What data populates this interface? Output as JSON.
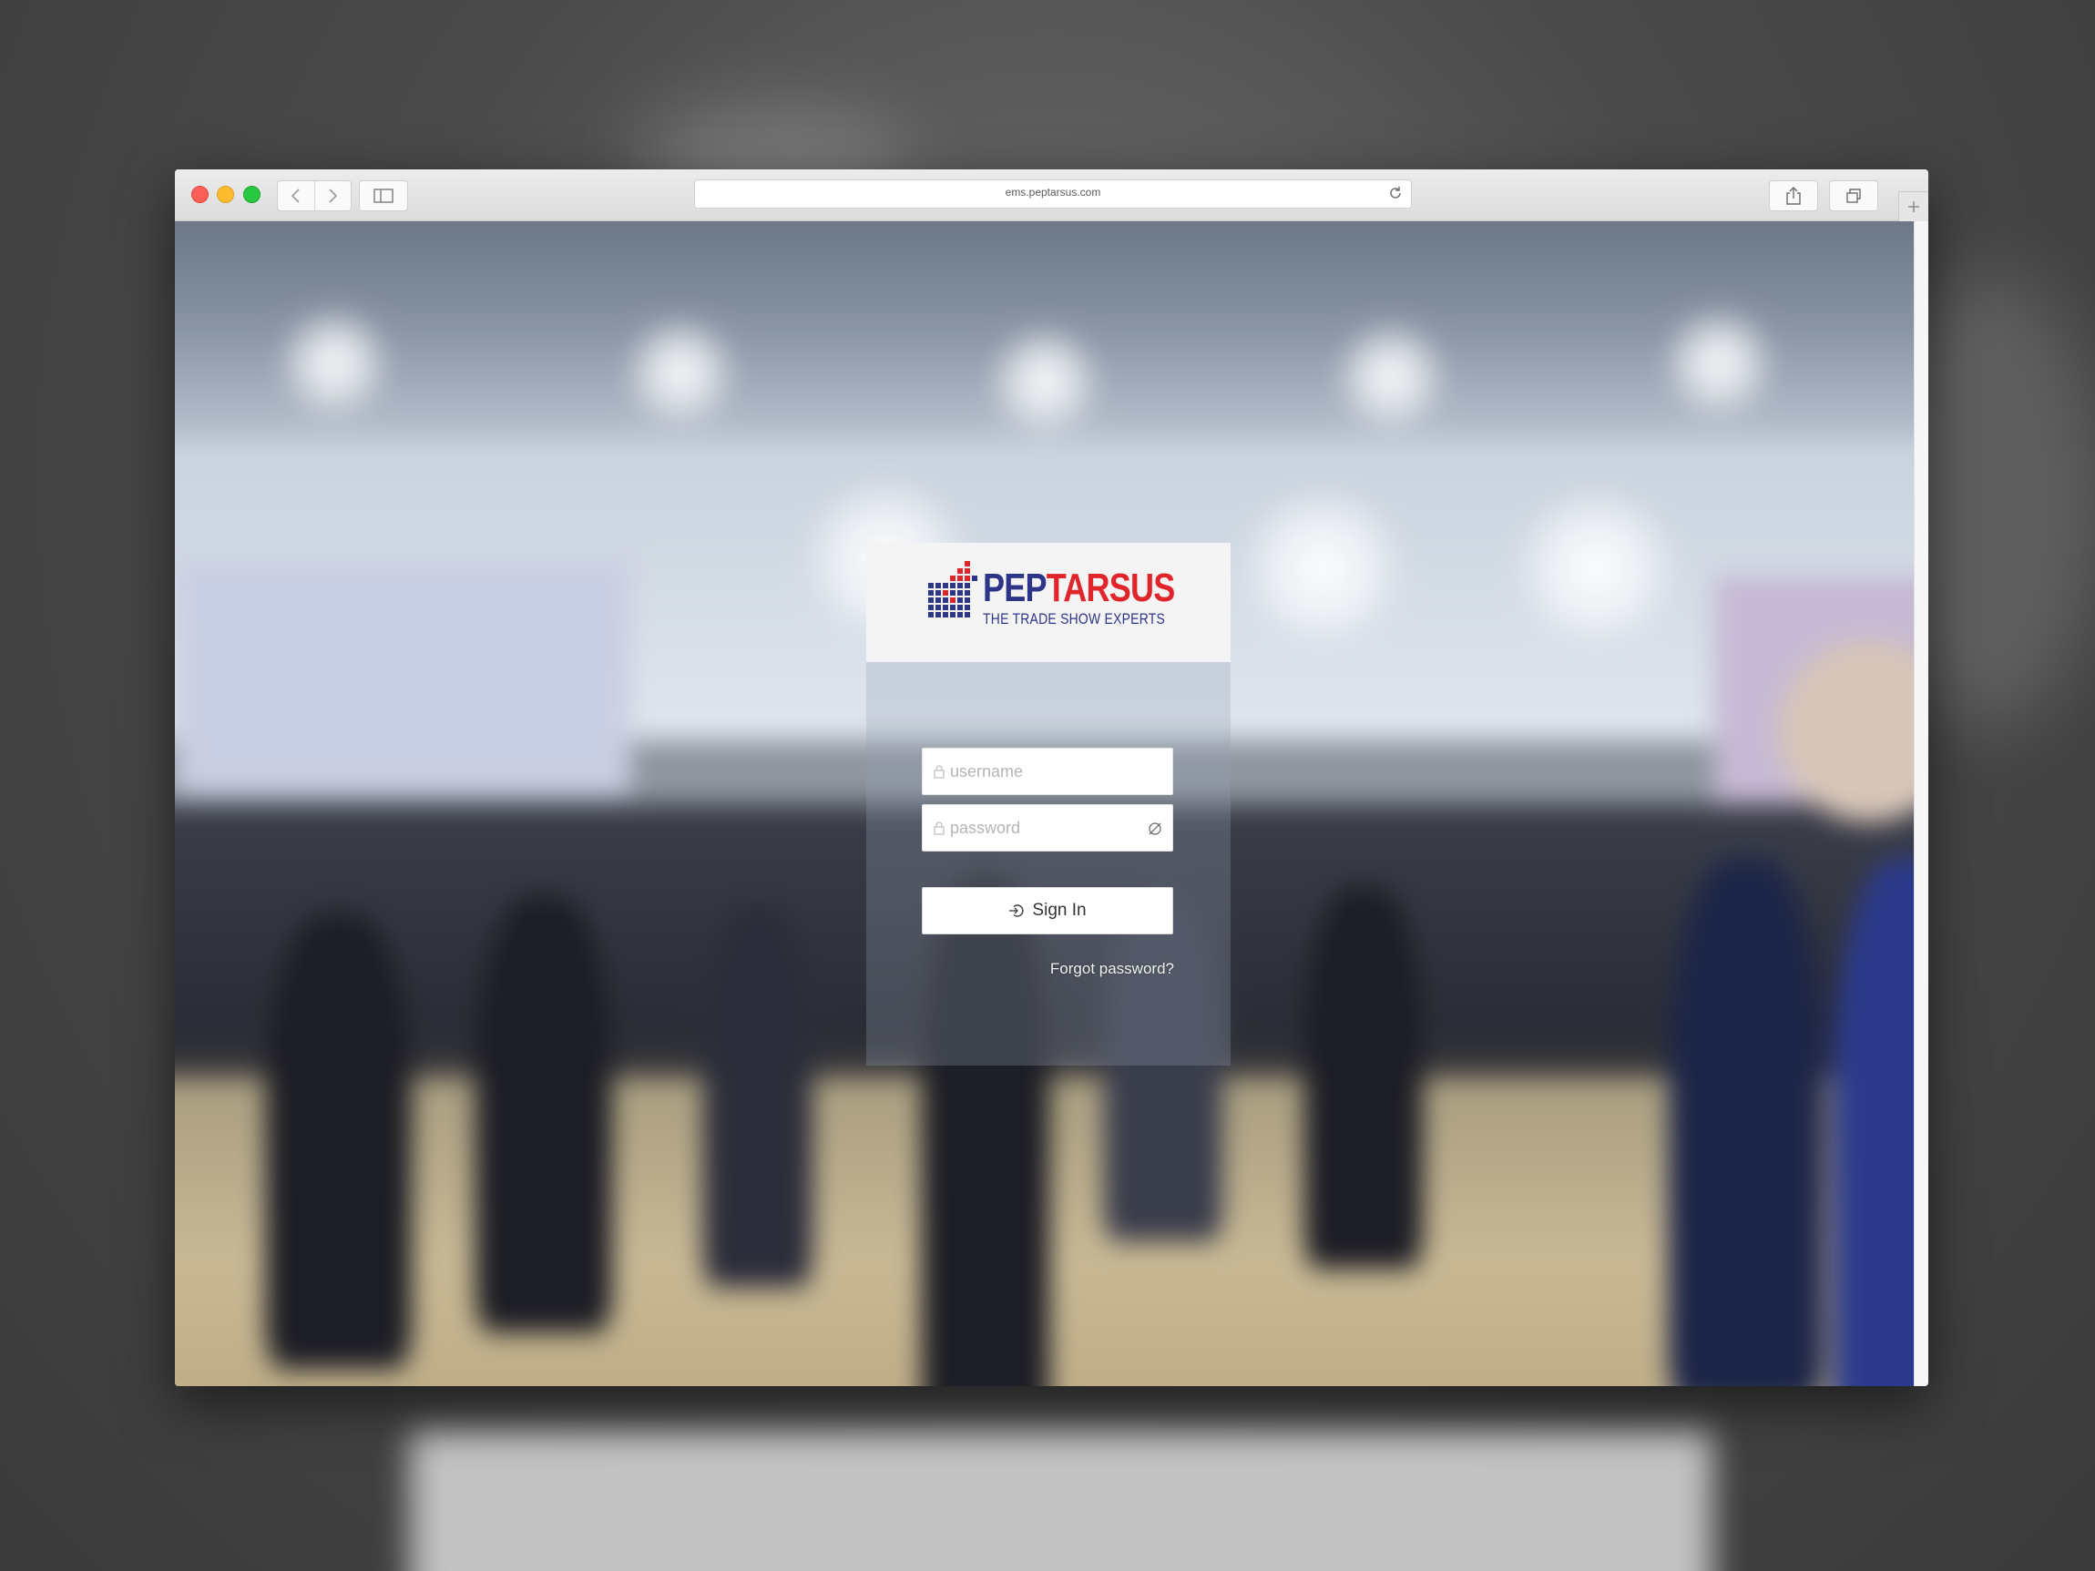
{
  "browser": {
    "url": "ems.peptarsus.com",
    "icons": {
      "back": "chevron-left-icon",
      "forward": "chevron-right-icon",
      "sidebar": "sidebar-icon",
      "reload": "reload-icon",
      "share": "share-icon",
      "tabs": "tabs-overview-icon",
      "new_tab": "plus-icon"
    }
  },
  "brand": {
    "name_part1": "PEP",
    "name_part2": "TARSUS",
    "tagline": "THE TRADE SHOW EXPERTS",
    "colors": {
      "blue": "#2d3588",
      "red": "#e0262b"
    }
  },
  "login": {
    "username_placeholder": "username",
    "password_placeholder": "password",
    "signin_label": "Sign In",
    "forgot_label": "Forgot password?"
  }
}
